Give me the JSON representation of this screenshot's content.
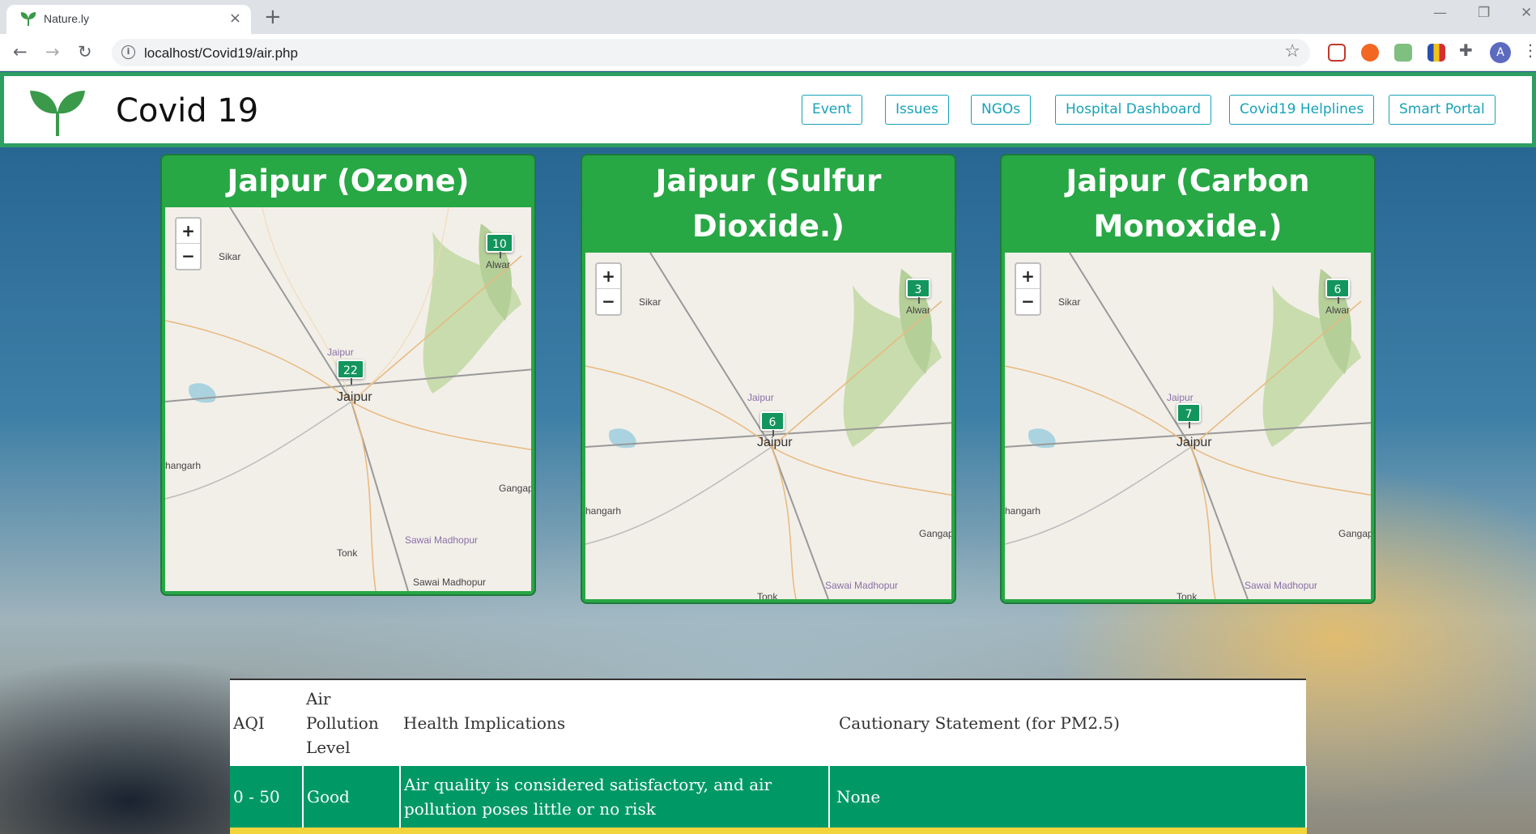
{
  "browser": {
    "tab_title": "Nature.ly",
    "url": "localhost/Covid19/air.php",
    "tab_close": "×",
    "new_tab": "+",
    "back": "←",
    "forward": "→",
    "reload": "↻",
    "star": "☆",
    "profile_initial": "A"
  },
  "header": {
    "brand": "Covid 19",
    "nav": [
      "Event",
      "Issues",
      "NGOs",
      "Hospital Dashboard",
      "Covid19 Helplines",
      "Smart Portal"
    ]
  },
  "maps": [
    {
      "title": "Jaipur (Ozone)",
      "markers": [
        {
          "label": "10",
          "place": "Alwar"
        },
        {
          "label": "22",
          "place": "Jaipur"
        }
      ],
      "places": [
        "Sikar",
        "Alwar",
        "Jaipur",
        "Jaipur",
        "hangarh",
        "Gangap",
        "Sawai Madhopur",
        "Tonk",
        "Sawai Madhopur"
      ]
    },
    {
      "title": "Jaipur (Sulfur Dioxide.)",
      "markers": [
        {
          "label": "3",
          "place": "Alwar"
        },
        {
          "label": "6",
          "place": "Jaipur"
        }
      ],
      "places": [
        "Sikar",
        "Alwar",
        "Jaipur",
        "Jaipur",
        "hangarh",
        "Gangap",
        "Sawai Madhopur",
        "Tonk"
      ]
    },
    {
      "title": "Jaipur (Carbon Monoxide.)",
      "markers": [
        {
          "label": "6",
          "place": "Alwar"
        },
        {
          "label": "7",
          "place": "Jaipur"
        }
      ],
      "places": [
        "Sikar",
        "Alwar",
        "Jaipur",
        "Jaipur",
        "hangarh",
        "Gangap",
        "Sawai Madhopur",
        "Tonk"
      ]
    }
  ],
  "zoom": {
    "in": "+",
    "out": "−"
  },
  "aqi_table": {
    "headers": [
      "AQI",
      "Air Pollution Level",
      "Health Implications",
      "Cautionary Statement (for PM2.5)"
    ],
    "rows": [
      [
        "0 - 50",
        "Good",
        "Air quality is considered satisfactory, and air pollution poses little or no risk",
        "None"
      ]
    ],
    "row_colors": [
      "#009966",
      "#f2d43c"
    ]
  }
}
